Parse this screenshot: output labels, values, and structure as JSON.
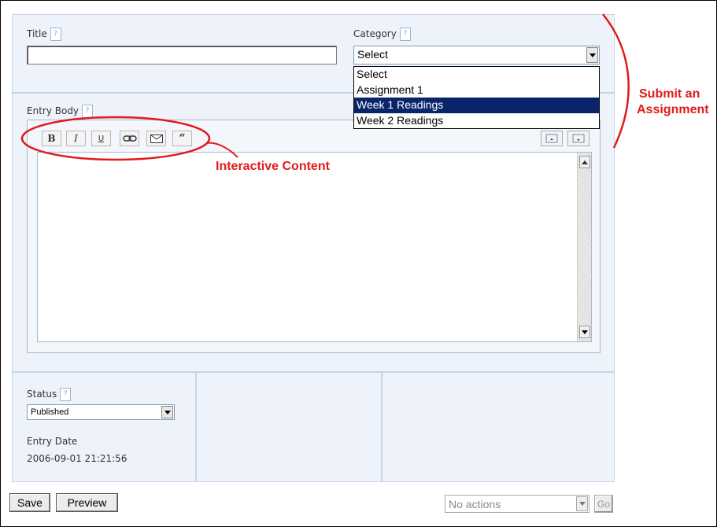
{
  "form": {
    "title_label": "Title",
    "title_value": "",
    "category_label": "Category",
    "category_selected": "Select",
    "category_options": [
      "Select",
      "Assignment 1",
      "Week 1 Readings",
      "Week 2 Readings"
    ],
    "category_highlighted_index": 2,
    "help_glyph": "?",
    "entry_body_label": "Entry Body"
  },
  "toolbar": {
    "bold": "B",
    "italic": "I",
    "underline": "U",
    "link_icon": "link-icon",
    "email_icon": "envelope-icon",
    "quote": "“",
    "expand_icons": [
      "expand-editor-icon",
      "shrink-editor-icon"
    ]
  },
  "status": {
    "label": "Status",
    "value": "Published",
    "entry_date_label": "Entry Date",
    "entry_date_value": "2006-09-01 21:21:56"
  },
  "actions": {
    "save_label": "Save",
    "preview_label": "Preview",
    "actions_placeholder": "No actions",
    "go_label": "Go"
  },
  "annotations": {
    "interactive_content": "Interactive Content",
    "submit_line1": "Submit an",
    "submit_line2": "Assignment",
    "color": "#e01b1b"
  }
}
